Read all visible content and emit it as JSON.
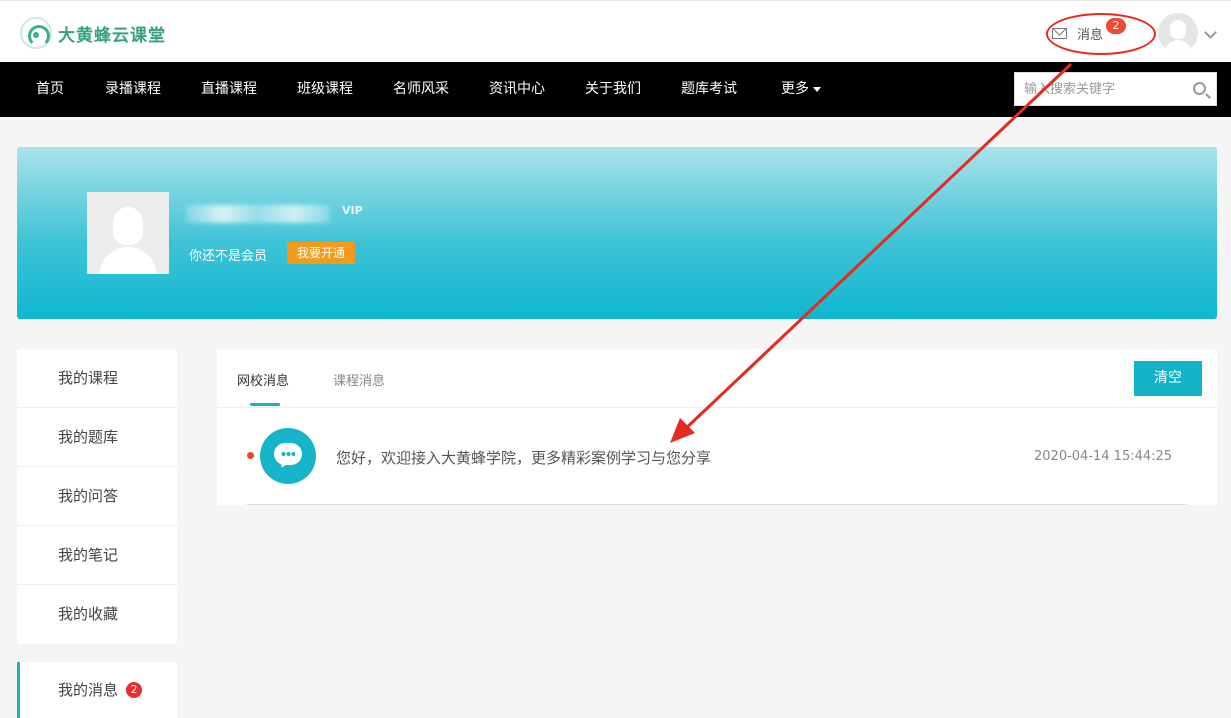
{
  "header": {
    "logo_text": "大黄蜂云课堂",
    "messages_label": "消息",
    "messages_badge": "2"
  },
  "nav": {
    "items": [
      "首页",
      "录播课程",
      "直播课程",
      "班级课程",
      "名师风采",
      "资讯中心",
      "关于我们",
      "题库考试"
    ],
    "more_label": "更多",
    "search_placeholder": "输入搜索关键字"
  },
  "profile": {
    "vip_label": "VIP",
    "member_status": "你还不是会员",
    "open_button": "我要开通"
  },
  "sidebar": {
    "items": [
      {
        "label": "我的课程"
      },
      {
        "label": "我的题库"
      },
      {
        "label": "我的问答"
      },
      {
        "label": "我的笔记"
      },
      {
        "label": "我的收藏"
      }
    ],
    "active": {
      "label": "我的消息",
      "badge": "2"
    }
  },
  "messages": {
    "tabs": [
      {
        "label": "网校消息",
        "active": true
      },
      {
        "label": "课程消息",
        "active": false
      }
    ],
    "clear_label": "清空",
    "list": [
      {
        "text": "您好，欢迎接入大黄蜂学院，更多精彩案例学习与您分享",
        "time": "2020-04-14 15:44:25",
        "unread": true
      }
    ]
  },
  "colors": {
    "brand_green": "#35a27d",
    "accent_cyan": "#12b3c8",
    "vip_orange": "#f29b1d",
    "badge_red": "#ee4b34",
    "annotation_red": "#e52a20"
  },
  "icons": [
    "mail-icon",
    "chevron-down-icon",
    "search-icon",
    "chat-bubble-icon",
    "avatar-placeholder"
  ]
}
